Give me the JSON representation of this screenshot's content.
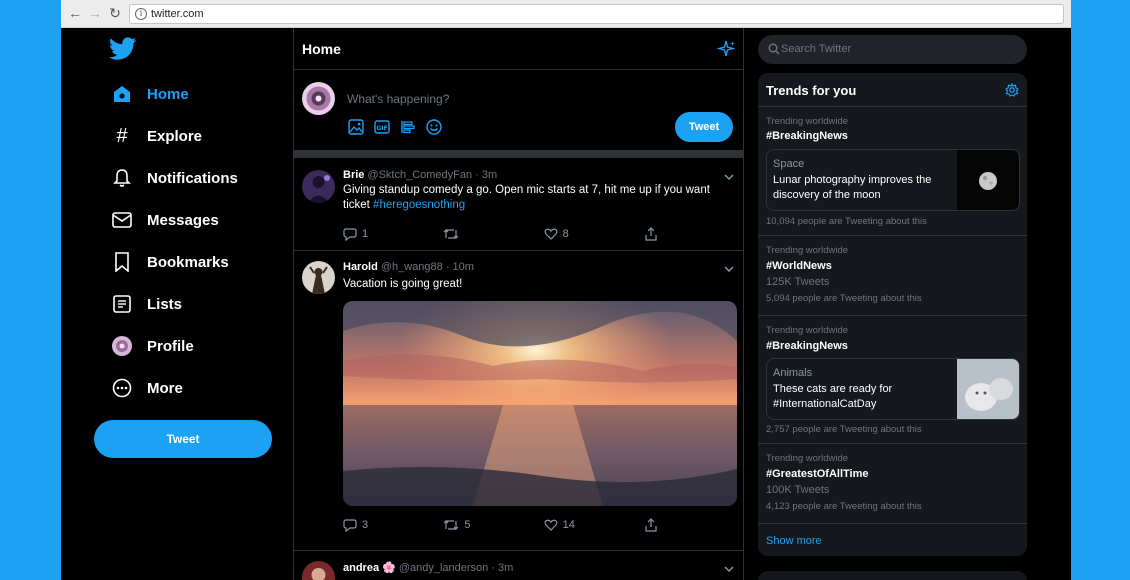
{
  "browser": {
    "url": "twitter.com"
  },
  "nav": {
    "items": [
      {
        "label": "Home",
        "icon": "home-icon",
        "active": true
      },
      {
        "label": "Explore",
        "icon": "hashtag-icon"
      },
      {
        "label": "Notifications",
        "icon": "bell-icon"
      },
      {
        "label": "Messages",
        "icon": "mail-icon"
      },
      {
        "label": "Bookmarks",
        "icon": "bookmark-icon"
      },
      {
        "label": "Lists",
        "icon": "list-icon"
      },
      {
        "label": "Profile",
        "icon": "avatar"
      },
      {
        "label": "More",
        "icon": "more-icon"
      }
    ],
    "tweet_label": "Tweet"
  },
  "timeline": {
    "title": "Home",
    "compose_placeholder": "What's happening?",
    "tweet_button": "Tweet",
    "tweets": [
      {
        "name": "Brie",
        "handle": "@Sktch_ComedyFan · 3m",
        "text": "Giving standup comedy a go. Open mic starts at 7, hit me up if you want ticket ",
        "hashtag": "#heregoesnothing",
        "replies": "1",
        "retweets": "",
        "likes": "8"
      },
      {
        "name": "Harold",
        "handle": "@h_wang88 · 10m",
        "text": "Vacation is going great!",
        "replies": "3",
        "retweets": "5",
        "likes": "14"
      },
      {
        "name": "andrea 🌸",
        "handle": "@andy_landerson · 3m"
      }
    ]
  },
  "sidebar": {
    "search_placeholder": "Search Twitter",
    "trends_title": "Trends for you",
    "trends": [
      {
        "meta": "Trending worldwide",
        "name": "#BreakingNews",
        "card": {
          "category": "Space",
          "text": "Lunar photography improves the discovery of the moon"
        },
        "people": "10,094 people are Tweeting about this"
      },
      {
        "meta": "Trending worldwide",
        "name": "#WorldNews",
        "count": "125K Tweets",
        "people": "5,094 people are Tweeting about this"
      },
      {
        "meta": "Trending worldwide",
        "name": "#BreakingNews",
        "card": {
          "category": "Animals",
          "text": "These cats are ready for #InternationalCatDay"
        },
        "people": "2,757 people are Tweeting about this"
      },
      {
        "meta": "Trending worldwide",
        "name": "#GreatestOfAllTime",
        "count": "100K Tweets",
        "people": "4,123 people are Tweeting about this"
      }
    ],
    "show_more": "Show more"
  },
  "colors": {
    "accent": "#1da1f2",
    "background": "#000000",
    "panel": "#15181c"
  }
}
